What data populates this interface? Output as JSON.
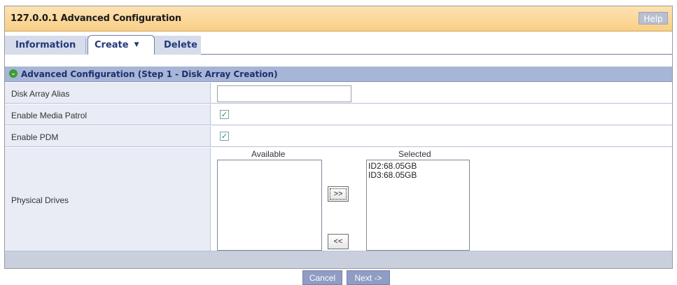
{
  "window": {
    "title": "127.0.0.1 Advanced Configuration",
    "help_label": "Help"
  },
  "tabs": [
    {
      "label": "Information"
    },
    {
      "label": "Create"
    },
    {
      "label": "Delete"
    }
  ],
  "section": {
    "title": "Advanced Configuration (Step 1 - Disk Array Creation)"
  },
  "form": {
    "alias_label": "Disk Array Alias",
    "alias_value": "",
    "media_patrol_label": "Enable Media Patrol",
    "media_patrol_checked": true,
    "pdm_label": "Enable PDM",
    "pdm_checked": true,
    "physical_drives_label": "Physical Drives",
    "available_label": "Available",
    "selected_label": "Selected",
    "available_items": [],
    "selected_items": [
      "ID2:68.05GB",
      "ID3:68.05GB"
    ],
    "add_label": ">>",
    "remove_label": "<<"
  },
  "footer": {
    "cancel_label": "Cancel",
    "next_label": "Next ->"
  }
}
